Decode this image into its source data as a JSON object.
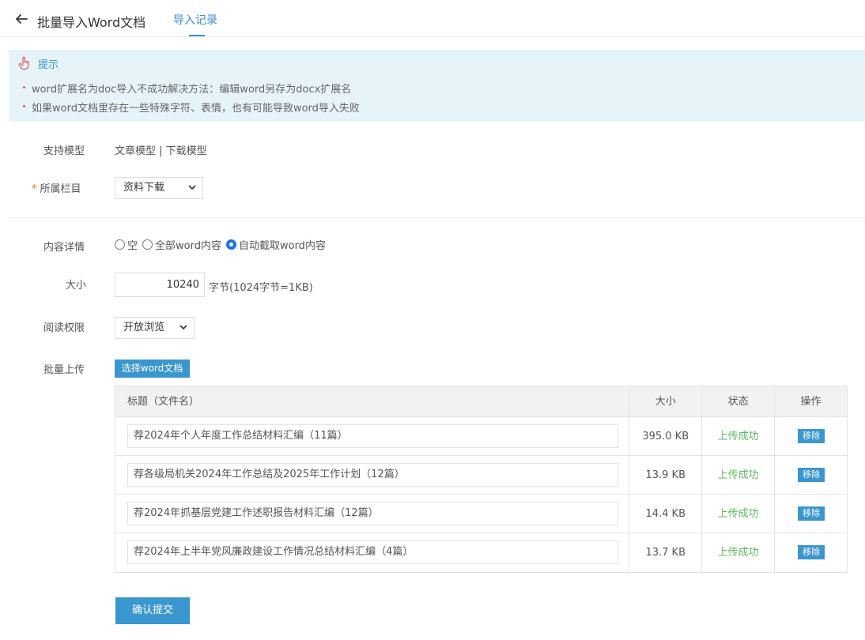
{
  "header": {
    "title": "批量导入Word文档",
    "tab_label": "导入记录"
  },
  "tip": {
    "title": "提示",
    "lines": [
      "word扩展名为doc导入不成功解决方法：编辑word另存为docx扩展名",
      "如果word文档里存在一些特殊字符、表情，也有可能导致word导入失败"
    ]
  },
  "form": {
    "model_label": "支持模型",
    "model_value": "文章模型 | 下载模型",
    "required_mark": "*",
    "category_label": "所属栏目",
    "category_value": "资料下载",
    "content_label": "内容详情",
    "content_options": [
      "空",
      "全部word内容",
      "自动截取word内容"
    ],
    "content_selected": "自动截取word内容",
    "size_label": "大小",
    "size_value": "10240",
    "size_unit": "字节(1024字节=1KB)",
    "permission_label": "阅读权限",
    "permission_value": "开放浏览",
    "upload_label": "批量上传",
    "choose_button": "选择word文档",
    "submit_button": "确认提交"
  },
  "table": {
    "headers": [
      "标题（文件名）",
      "大小",
      "状态",
      "操作"
    ],
    "rows": [
      {
        "title": "荐2024年个人年度工作总结材料汇编（11篇）",
        "size": "395.0 KB",
        "status": "上传成功",
        "action": "移除"
      },
      {
        "title": "荐各级局机关2024年工作总结及2025年工作计划（12篇）",
        "size": "13.9 KB",
        "status": "上传成功",
        "action": "移除"
      },
      {
        "title": "荐2024年抓基层党建工作述职报告材料汇编（12篇）",
        "size": "14.4 KB",
        "status": "上传成功",
        "action": "移除"
      },
      {
        "title": "荐2024年上半年党风廉政建设工作情况总结材料汇编（4篇）",
        "size": "13.7 KB",
        "status": "上传成功",
        "action": "移除"
      }
    ]
  },
  "colors": {
    "accent": "#3a96cf",
    "success": "#5cb85c",
    "tip_bg": "#e6f4fa",
    "required": "#e8782d"
  },
  "icons": {
    "back": "arrow-left-icon",
    "tip": "hand-pointer-icon",
    "caret": "chevron-down-icon"
  }
}
